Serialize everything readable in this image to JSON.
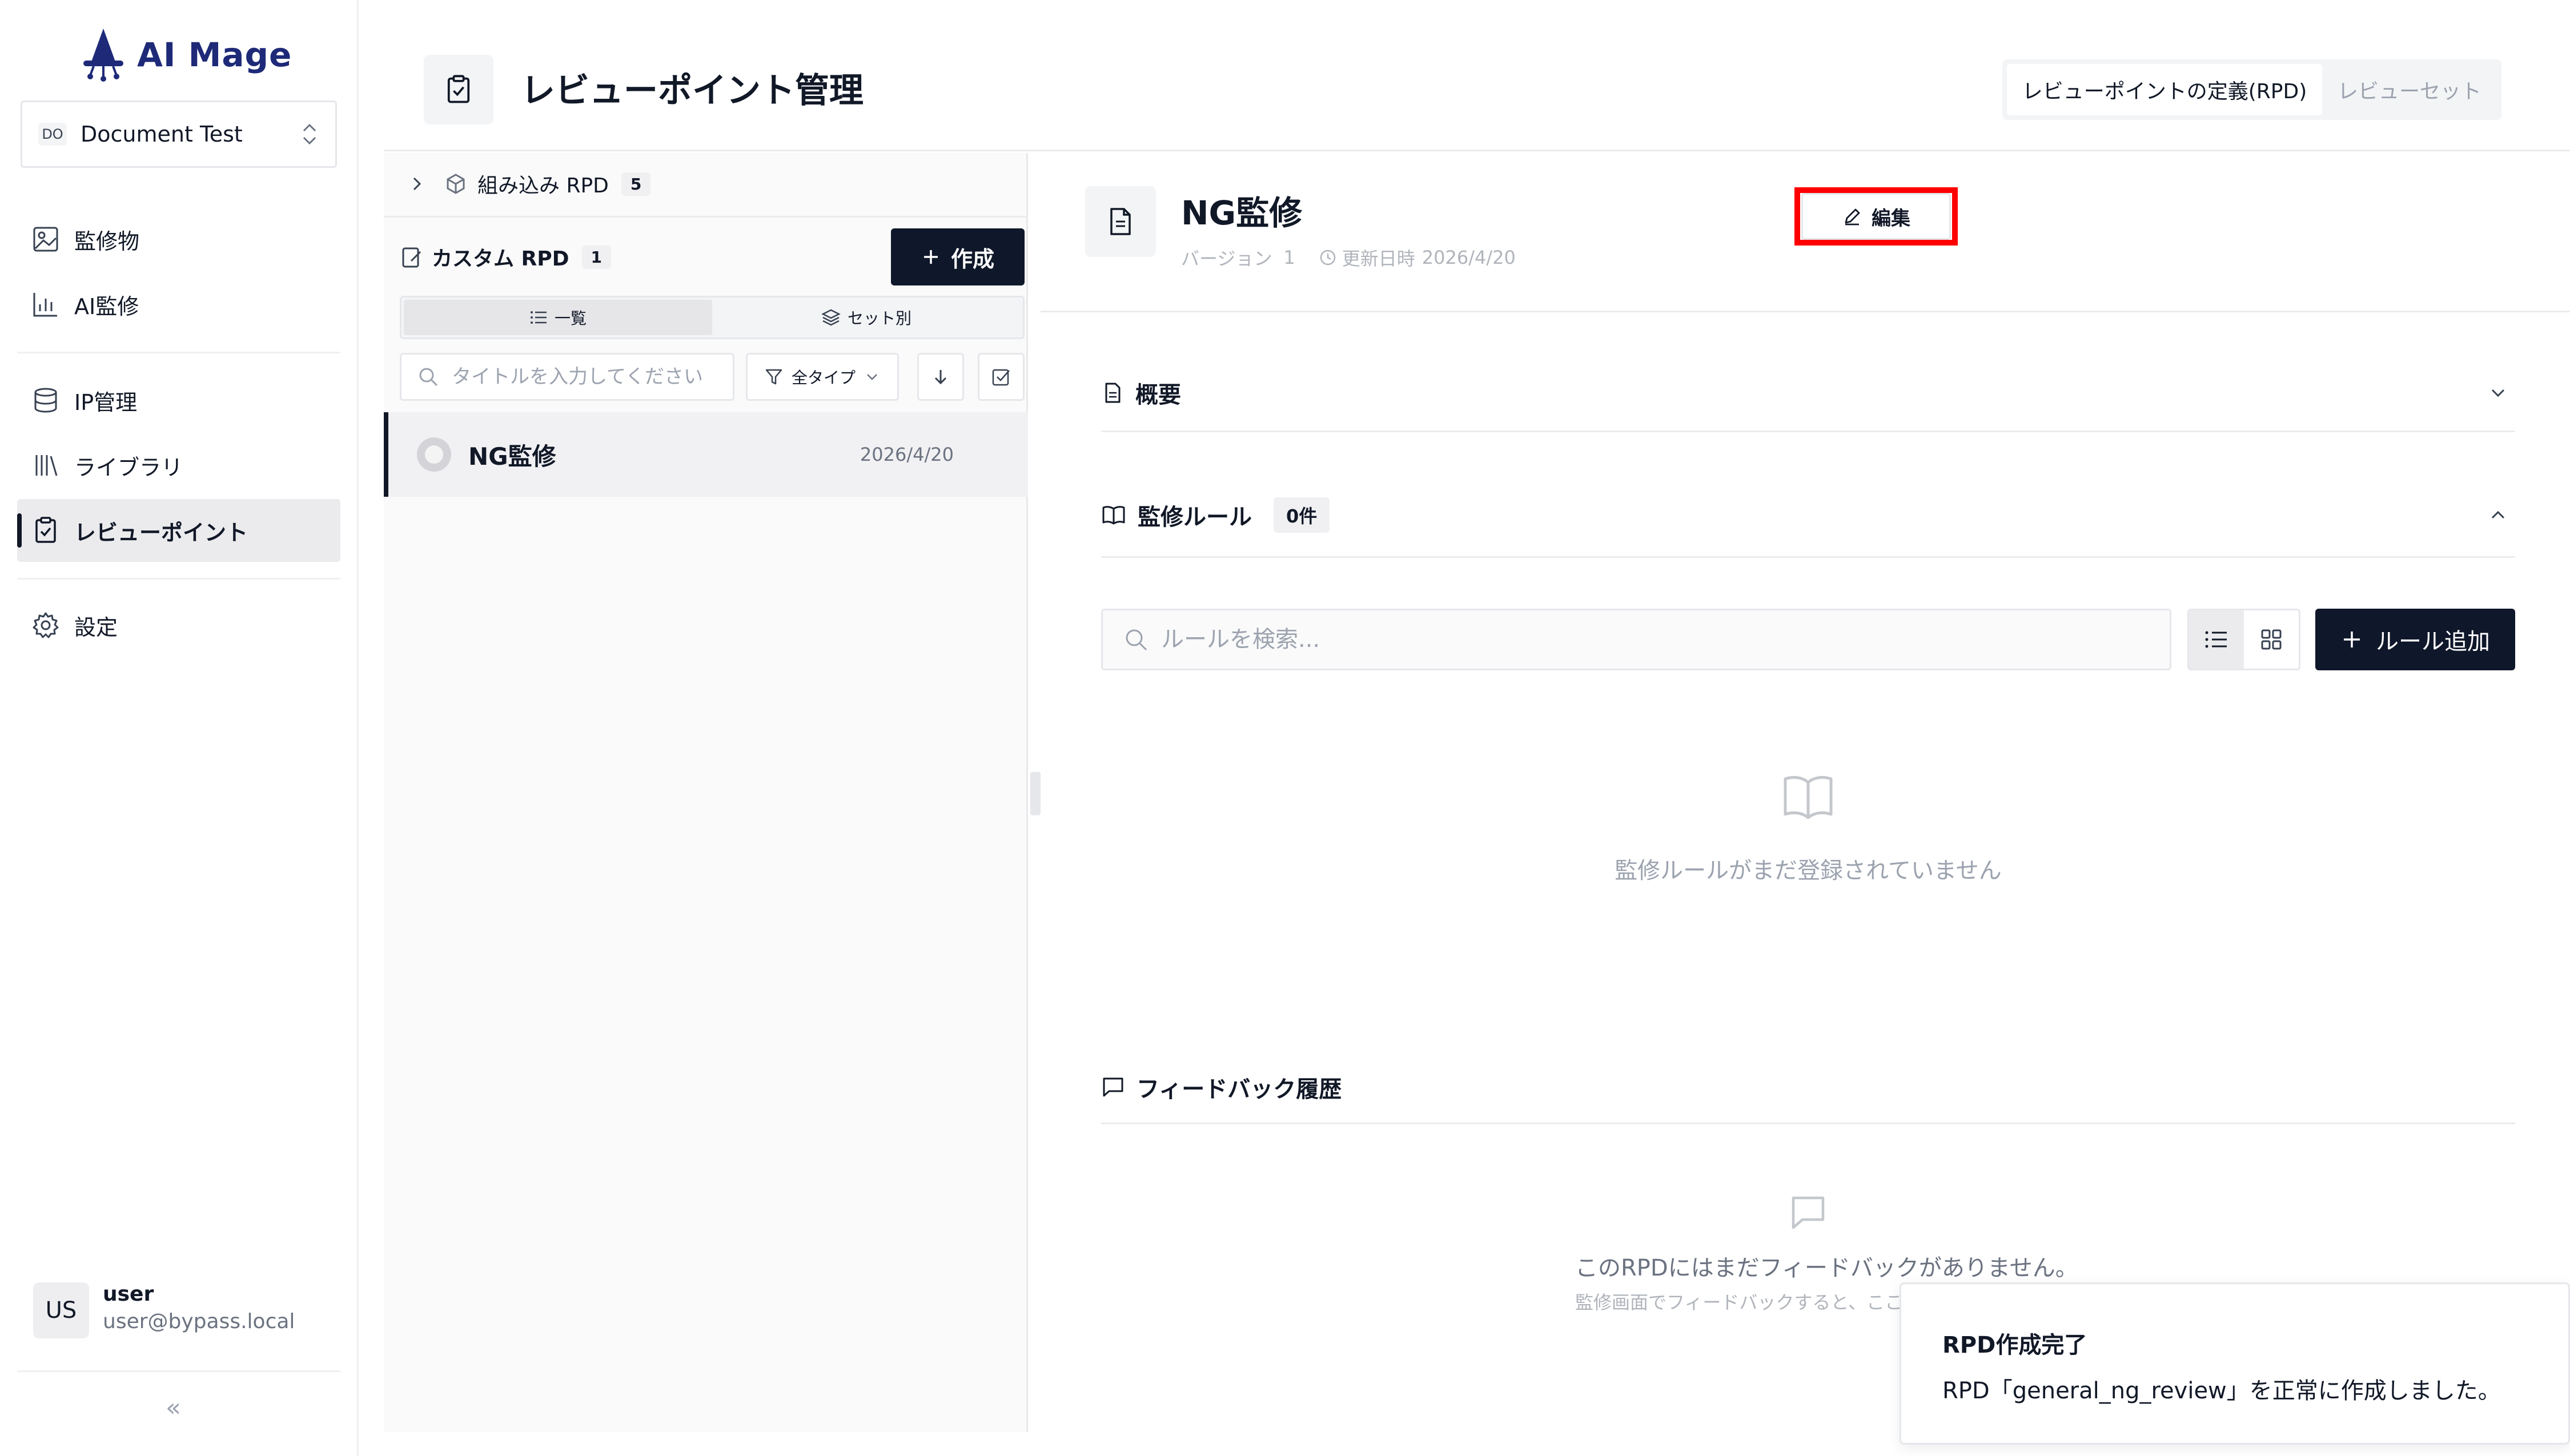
{
  "app": {
    "name": "AI Mage"
  },
  "workspace": {
    "badge": "DO",
    "name": "Document Test"
  },
  "nav": {
    "items": [
      {
        "label": "監修物",
        "icon": "image-icon"
      },
      {
        "label": "AI監修",
        "icon": "chart-icon"
      },
      {
        "label": "IP管理",
        "icon": "database-icon"
      },
      {
        "label": "ライブラリ",
        "icon": "library-icon"
      },
      {
        "label": "レビューポイント",
        "icon": "clipboard-check-icon",
        "active": true
      },
      {
        "label": "設定",
        "icon": "gear-icon"
      }
    ]
  },
  "user": {
    "initials": "US",
    "name": "user",
    "email": "user@bypass.local"
  },
  "sidebar_collapse": "«",
  "header": {
    "title": "レビューポイント管理",
    "tabs": [
      {
        "label": "レビューポイントの定義(RPD)",
        "active": true
      },
      {
        "label": "レビューセット",
        "active": false
      }
    ]
  },
  "left_panel": {
    "builtin": {
      "label": "組み込み RPD",
      "count": "5"
    },
    "custom": {
      "label": "カスタム RPD",
      "count": "1"
    },
    "create_label": "作成",
    "segments": [
      {
        "label": "一覧",
        "active": true
      },
      {
        "label": "セット別",
        "active": false
      }
    ],
    "search_placeholder": "タイトルを入力してください",
    "type_filter": "全タイプ",
    "items": [
      {
        "title": "NG監修",
        "date": "2026/4/20",
        "selected": true
      }
    ]
  },
  "detail": {
    "title": "NG監修",
    "version_label": "バージョン",
    "version": "1",
    "updated_label": "更新日時",
    "updated": "2026/4/20",
    "edit_label": "編集",
    "overview_title": "概要",
    "rules_title": "監修ルール",
    "rules_count": "0件",
    "rule_search_placeholder": "ルールを検索...",
    "add_rule_label": "ルール追加",
    "rules_empty": "監修ルールがまだ登録されていません",
    "feedback_title": "フィードバック履歴",
    "feedback_empty": "このRPDにはまだフィードバックがありません。",
    "feedback_hint": "監修画面でフィードバックすると、ここに"
  },
  "toast": {
    "title": "RPD作成完了",
    "message": "RPD「general_ng_review」を正常に作成しました。"
  },
  "colors": {
    "brand": "#1e2a78",
    "primary_button": "#0f172a",
    "highlight": "#ff0000"
  }
}
